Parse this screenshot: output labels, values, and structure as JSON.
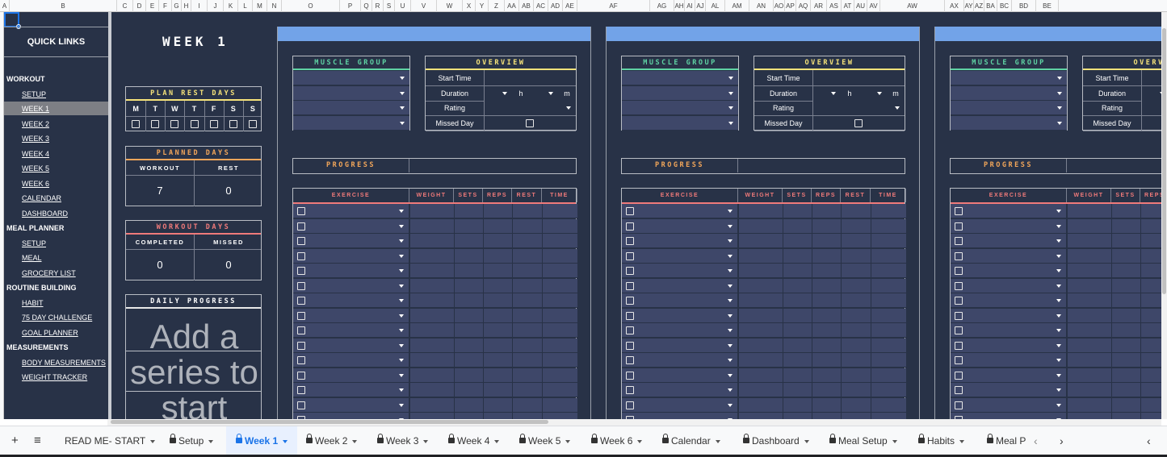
{
  "columns": [
    "A",
    "B",
    "C",
    "D",
    "E",
    "F",
    "G",
    "H",
    "I",
    "J",
    "K",
    "L",
    "M",
    "N",
    "O",
    "P",
    "Q",
    "R",
    "S",
    "U",
    "V",
    "W",
    "X",
    "Y",
    "Z",
    "AA",
    "AB",
    "AC",
    "AD",
    "AE",
    "AF",
    "AG",
    "AH",
    "AI",
    "AJ",
    "AL",
    "AM",
    "AN",
    "AO",
    "AP",
    "AQ",
    "AR",
    "AS",
    "AT",
    "AU",
    "AV",
    "AW",
    "AX",
    "AY",
    "AZ",
    "BA",
    "BC",
    "BD",
    "BE"
  ],
  "sidebar": {
    "title": "QUICK LINKS",
    "workout": "WORKOUT",
    "workout_links": [
      "SETUP",
      "WEEK 1",
      "WEEK 2",
      "WEEK 3",
      "WEEK 4",
      "WEEK 5",
      "WEEK 6",
      "CALENDAR",
      "DASHBOARD"
    ],
    "meal": "MEAL PLANNER",
    "meal_links": [
      "SETUP",
      "MEAL",
      "GROCERY LIST"
    ],
    "routine": "ROUTINE BUILDING",
    "routine_links": [
      "HABIT",
      "75 DAY CHALLENGE",
      "GOAL PLANNER"
    ],
    "measure": "MEASUREMENTS",
    "measure_links": [
      "BODY MEASUREMENTS",
      "WEIGHT TRACKER"
    ],
    "selected": "WEEK 1"
  },
  "week_title": "WEEK 1",
  "plan_rest": {
    "title": "PLAN REST DAYS",
    "days": [
      "M",
      "T",
      "W",
      "T",
      "F",
      "S",
      "S"
    ]
  },
  "planned": {
    "title": "PLANNED DAYS",
    "workout_label": "WORKOUT",
    "rest_label": "REST",
    "workout": "7",
    "rest": "0"
  },
  "workout_days": {
    "title": "WORKOUT DAYS",
    "completed_label": "COMPLETED",
    "missed_label": "MISSED",
    "completed": "0",
    "missed": "0"
  },
  "daily": {
    "title": "DAILY PROGRESS",
    "placeholder": "Add a series to start"
  },
  "panel": {
    "muscle_group": "MUSCLE GROUP",
    "overview": "OVERVIEW",
    "start_time": "Start Time",
    "duration": "Duration",
    "h": "h",
    "m": "m",
    "rating": "Rating",
    "missed_day": "Missed Day",
    "progress": "PROGRESS",
    "cols": [
      "EXERCISE",
      "WEIGHT",
      "SETS",
      "REPS",
      "REST",
      "TIME"
    ]
  },
  "colors": {
    "bg": "#283247",
    "cell": "#3e4769",
    "accent_blue": "#72a3e8",
    "green": "#5fd3a4",
    "yellow": "#f5e27a",
    "orange": "#f2a65a",
    "red": "#f07a7a"
  },
  "tabs": [
    {
      "label": "+",
      "icon": "add-sheet-icon"
    },
    {
      "label": "≡",
      "icon": "all-sheets-icon"
    },
    {
      "label": "READ ME- START",
      "lock": false
    },
    {
      "label": "Setup",
      "lock": true
    },
    {
      "label": "Week 1",
      "lock": true,
      "active": true
    },
    {
      "label": "Week 2",
      "lock": true
    },
    {
      "label": "Week 3",
      "lock": true
    },
    {
      "label": "Week 4",
      "lock": true
    },
    {
      "label": "Week 5",
      "lock": true
    },
    {
      "label": "Week 6",
      "lock": true
    },
    {
      "label": "Calendar",
      "lock": true
    },
    {
      "label": "Dashboard",
      "lock": true
    },
    {
      "label": "Meal Setup",
      "lock": true
    },
    {
      "label": "Habits",
      "lock": true
    },
    {
      "label": "Meal P",
      "lock": true
    }
  ]
}
